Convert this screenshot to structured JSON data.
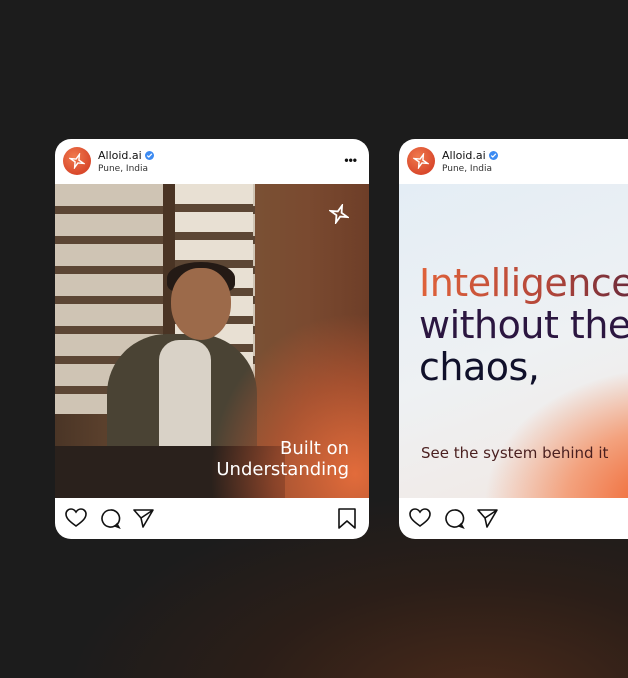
{
  "posts": [
    {
      "username": "Alloid.ai",
      "location": "Pune, India",
      "caption": [
        "Built on",
        "Understanding"
      ],
      "icons": [
        "heart-icon",
        "comment-icon",
        "share-icon",
        "bookmark-icon"
      ]
    },
    {
      "username": "Alloid.ai",
      "location": "Pune, India",
      "headline": [
        "Intelligence",
        "without the",
        "chaos,"
      ],
      "subtext": "See the system behind it",
      "icons": [
        "heart-icon",
        "comment-icon",
        "share-icon"
      ]
    }
  ],
  "colors": {
    "accent": "#e2582c",
    "verified": "#3d8bf2",
    "background": "#1c1c1c"
  }
}
